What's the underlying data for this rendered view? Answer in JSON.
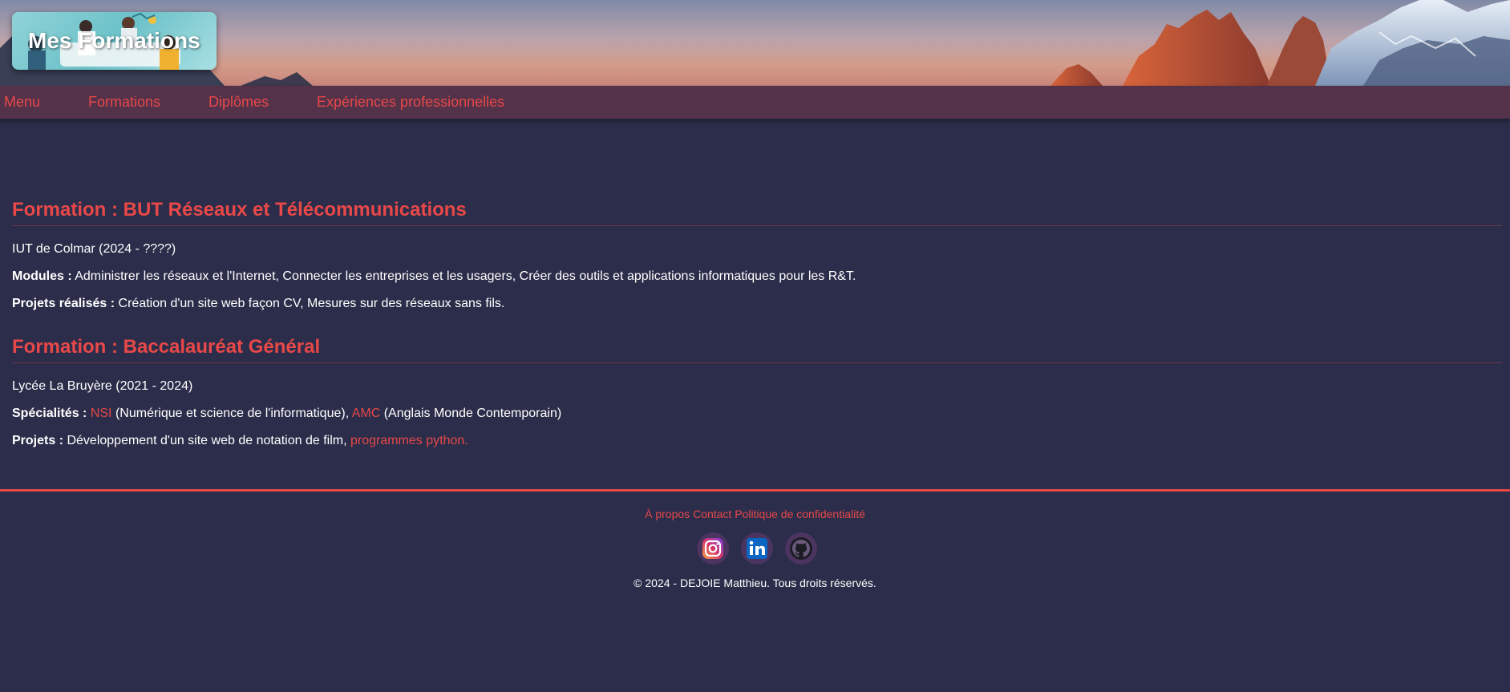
{
  "header": {
    "title": "Mes Formations"
  },
  "nav": {
    "items": [
      {
        "label": "Menu"
      },
      {
        "label": "Formations"
      },
      {
        "label": "Diplômes"
      },
      {
        "label": "Expériences professionnelles"
      }
    ]
  },
  "sections": [
    {
      "title": "Formation : BUT Réseaux et Télécommunications",
      "school": "IUT de Colmar (2024 - ????)",
      "modules_label": "Modules :",
      "modules_text": "Administrer les réseaux et l'Internet, Connecter les entreprises et les usagers, Créer des outils et applications informatiques pour les R&T.",
      "projects_label": "Projets réalisés :",
      "projects_text": "Création d'un site web façon CV, Mesures sur des réseaux sans fils."
    },
    {
      "title": "Formation : Baccalauréat Général",
      "school": "Lycée La Bruyère (2021 - 2024)",
      "specialties_label": "Spécialités :",
      "spec1_abbr": "NSI",
      "spec1_text": "(Numérique et science de l'informatique),",
      "spec2_abbr": "AMC",
      "spec2_text": "(Anglais Monde Contemporain)",
      "projects_label": "Projets :",
      "projects_text": "Développement d'un site web de notation de film,",
      "projects_link": "programmes python."
    }
  ],
  "footer": {
    "links": [
      {
        "label": "À propos"
      },
      {
        "label": "Contact"
      },
      {
        "label": "Politique de confidentialité"
      }
    ],
    "socials": [
      {
        "icon": "instagram-icon"
      },
      {
        "icon": "linkedin-icon"
      },
      {
        "icon": "github-icon"
      }
    ],
    "copyright": "© 2024 - DEJOIE Matthieu. Tous droits réservés."
  },
  "colors": {
    "background": "#2b2d4a",
    "accent": "#e84848",
    "nav_bg": "#53324a"
  }
}
